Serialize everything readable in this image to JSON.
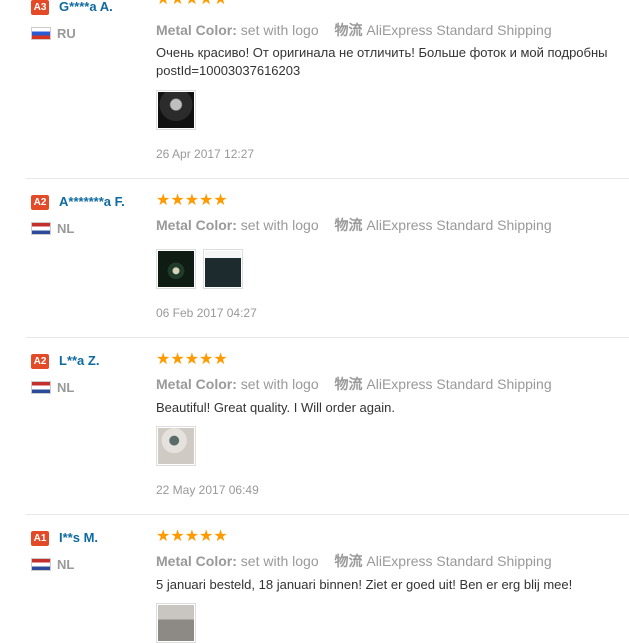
{
  "reviews": [
    {
      "level": "A3",
      "name": "G****a A.",
      "country": "RU",
      "flag": "ru",
      "stars": "★★★★★",
      "metal_color_label": "Metal Color:",
      "metal_color_value": "set with logo",
      "shipping_label": "物流",
      "shipping_value": "AliExpress Standard Shipping",
      "text_lines": [
        "Очень красиво! От оригинала не отличить! Больше фоток и мой подробны",
        "postId=10003037616203"
      ],
      "date": "26 Apr 2017 12:27"
    },
    {
      "level": "A2",
      "name": "A*******a F.",
      "country": "NL",
      "flag": "nl",
      "stars": "★★★★★",
      "metal_color_label": "Metal Color:",
      "metal_color_value": "set with logo",
      "shipping_label": "物流",
      "shipping_value": "AliExpress Standard Shipping",
      "text_lines": [],
      "date": "06 Feb 2017 04:27"
    },
    {
      "level": "A2",
      "name": "L**a Z.",
      "country": "NL",
      "flag": "nl",
      "stars": "★★★★★",
      "metal_color_label": "Metal Color:",
      "metal_color_value": "set with logo",
      "shipping_label": "物流",
      "shipping_value": "AliExpress Standard Shipping",
      "text_lines": [
        "Beautiful! Great quality. I Will order again."
      ],
      "date": "22 May 2017 06:49"
    },
    {
      "level": "A1",
      "name": "I**s M.",
      "country": "NL",
      "flag": "nl",
      "stars": "★★★★★",
      "metal_color_label": "Metal Color:",
      "metal_color_value": "set with logo",
      "shipping_label": "物流",
      "shipping_value": "AliExpress Standard Shipping",
      "text_lines": [
        "5 januari besteld, 18 januari binnen! Ziet er goed uit! Ben er erg blij mee!"
      ],
      "date": ""
    }
  ]
}
